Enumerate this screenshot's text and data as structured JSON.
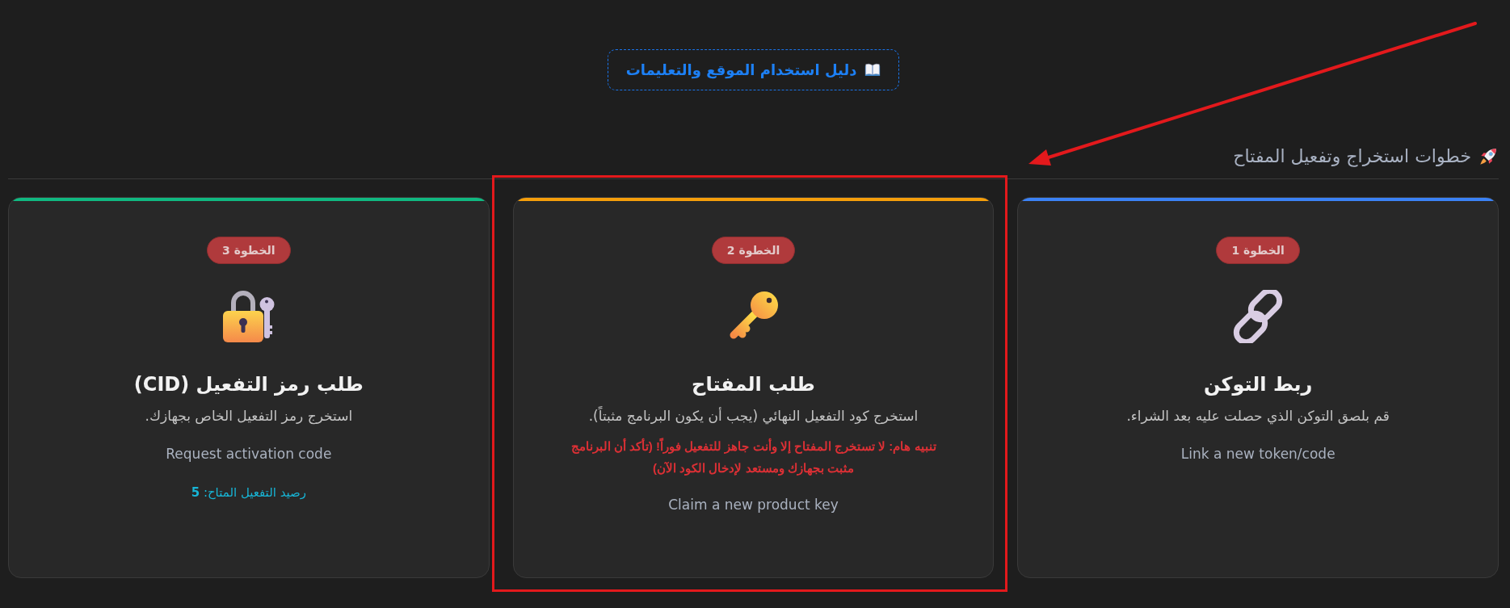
{
  "guide_link": {
    "label": "دليل استخدام الموقع والتعليمات"
  },
  "section": {
    "title": "خطوات استخراج وتفعيل المفتاح"
  },
  "steps": [
    {
      "kind": "link",
      "color": "#3b82f6",
      "highlighted": false,
      "badge": "الخطوة 1",
      "title": "ربط التوكن",
      "description": "قم بلصق التوكن الذي حصلت عليه بعد الشراء.",
      "action": "Link a new token/code"
    },
    {
      "kind": "key",
      "color": "#f59e0b",
      "highlighted": true,
      "badge": "الخطوة 2",
      "title": "طلب المفتاح",
      "description": "استخرج كود التفعيل النهائي (يجب أن يكون البرنامج مثبتاً).",
      "warning": "تنبيه هام: لا تستخرج المفتاح إلا وأنت جاهز للتفعيل فوراً! (تأكد أن البرنامج مثبت بجهازك ومستعد لإدخال الكود الآن)",
      "action": "Claim a new product key"
    },
    {
      "kind": "lock",
      "color": "#10b981",
      "highlighted": false,
      "badge": "الخطوة 3",
      "title": "طلب رمز التفعيل (CID)",
      "description": "استخرج رمز التفعيل الخاص بجهازك.",
      "action": "Request activation code",
      "balance": "رصيد التفعيل المتاح: **5**"
    }
  ],
  "annotations": [
    {
      "kind": "arrow"
    }
  ]
}
